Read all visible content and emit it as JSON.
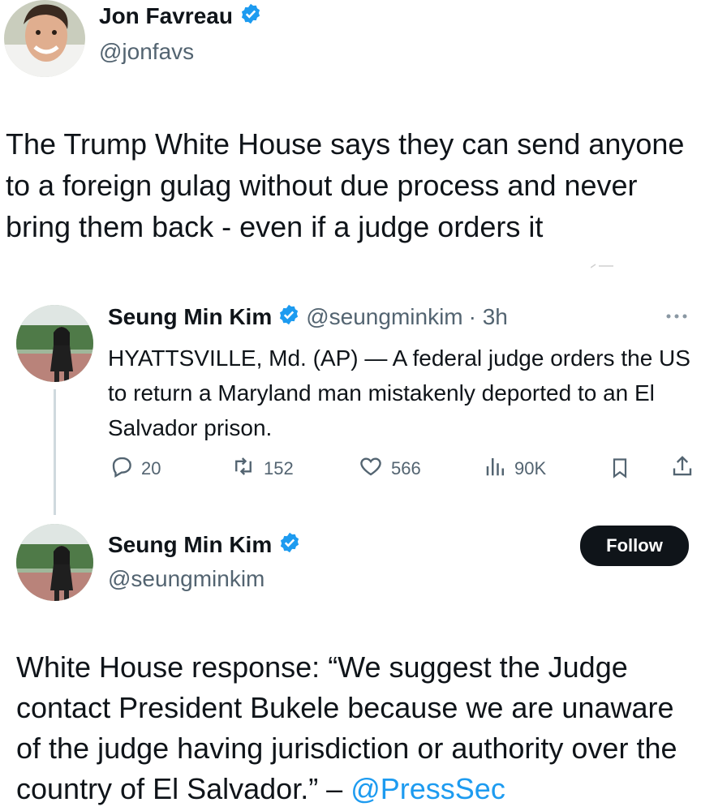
{
  "main_tweet": {
    "author_name": "Jon Favreau",
    "handle": "@jonfavs",
    "text": "The Trump White House says they can send anyone to a foreign gulag without due process and never bring them back - even if a judge orders it"
  },
  "quoted_tweet": {
    "author_name": "Seung Min Kim",
    "handle": "@seungminkim",
    "time": "· 3h",
    "text": "HYATTSVILLE, Md. (AP) — A federal judge orders the US to return a Maryland man mistakenly deported to an El Salvador prison.",
    "actions": {
      "replies": "20",
      "reposts": "152",
      "likes": "566",
      "views": "90K"
    }
  },
  "reply_tweet": {
    "author_name": "Seung Min Kim",
    "handle": "@seungminkim",
    "follow_label": "Follow",
    "text_prefix": "White House response: “We suggest the Judge contact President Bukele because we are unaware of the judge having jurisdiction or authority over the country of El Salvador.” – ",
    "mention": "@PressSec"
  },
  "colors": {
    "verified": "#1d9bf0",
    "text_primary": "#0f1419",
    "text_secondary": "#536471",
    "link": "#1d9bf0"
  },
  "icons": [
    "verified-badge-icon",
    "more-icon",
    "reply-icon",
    "repost-icon",
    "like-icon",
    "views-icon",
    "bookmark-icon",
    "share-icon"
  ]
}
